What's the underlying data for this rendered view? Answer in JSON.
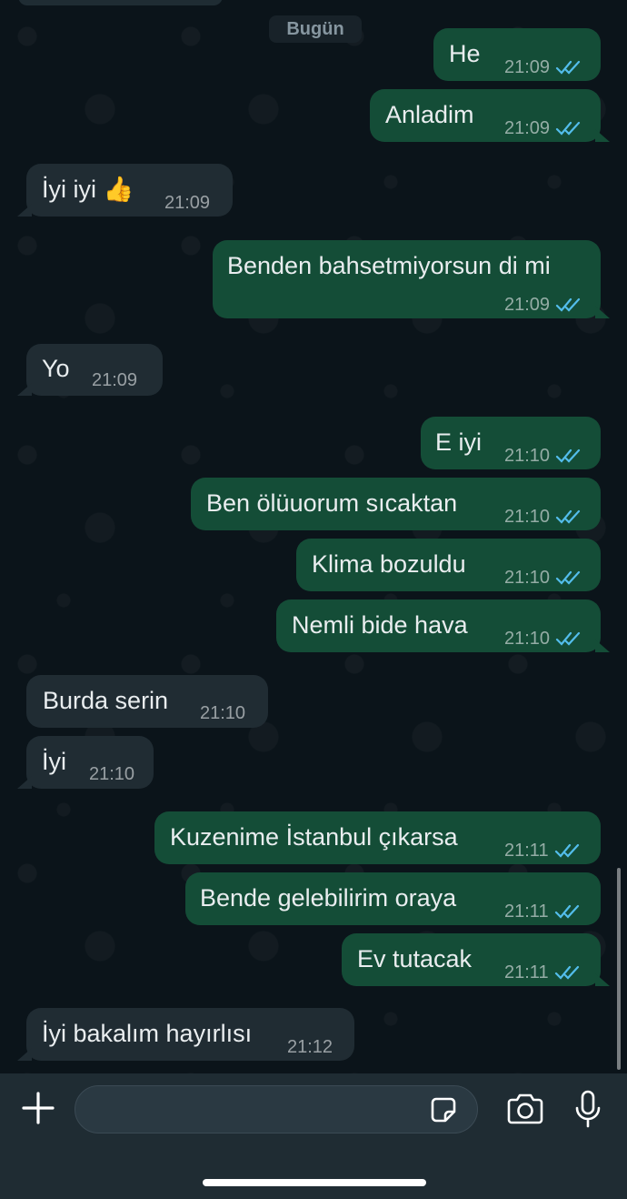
{
  "date_separator": "Bugün",
  "messages": [
    {
      "text": "He",
      "time": "21:09",
      "direction": "outgoing"
    },
    {
      "text": "Anladim",
      "time": "21:09",
      "direction": "outgoing"
    },
    {
      "text": "İyi iyi 👍",
      "time": "21:09",
      "direction": "incoming"
    },
    {
      "text": "Benden bahsetmiyorsun di mi",
      "time": "21:09",
      "direction": "outgoing"
    },
    {
      "text": "Yo",
      "time": "21:09",
      "direction": "incoming"
    },
    {
      "text": "E iyi",
      "time": "21:10",
      "direction": "outgoing"
    },
    {
      "text": "Ben ölüuorum sıcaktan",
      "time": "21:10",
      "direction": "outgoing"
    },
    {
      "text": "Klima bozuldu",
      "time": "21:10",
      "direction": "outgoing"
    },
    {
      "text": "Nemli bide hava",
      "time": "21:10",
      "direction": "outgoing"
    },
    {
      "text": "Burda serin",
      "time": "21:10",
      "direction": "incoming"
    },
    {
      "text": "İyi",
      "time": "21:10",
      "direction": "incoming"
    },
    {
      "text": "Kuzenime İstanbul çıkarsa",
      "time": "21:11",
      "direction": "outgoing"
    },
    {
      "text": "Bende gelebilirim oraya",
      "time": "21:11",
      "direction": "outgoing"
    },
    {
      "text": "Ev tutacak",
      "time": "21:11",
      "direction": "outgoing"
    },
    {
      "text": "İyi bakalım hayırlısı",
      "time": "21:12",
      "direction": "incoming"
    }
  ],
  "composer": {
    "input_value": "",
    "icons": [
      "plus-icon",
      "sticker-icon",
      "camera-icon",
      "microphone-icon"
    ]
  },
  "colors": {
    "background": "#0b141a",
    "outgoing_bubble": "#144d37",
    "incoming_bubble": "#202c33",
    "read_ticks": "#53bdeb",
    "composer_bar": "#1f2c33"
  }
}
